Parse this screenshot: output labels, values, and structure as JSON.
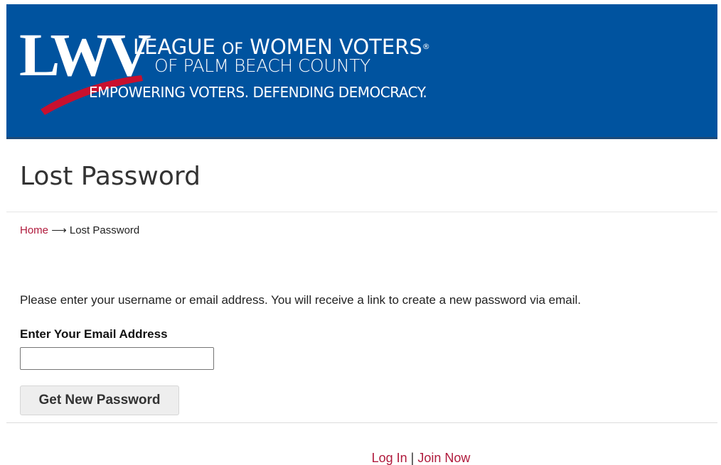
{
  "header": {
    "logo_letters": "LWV",
    "org_name_line1_a": "LEAGUE",
    "org_name_line1_of": "OF",
    "org_name_line1_b": "WOMEN VOTERS",
    "org_name_reg": "®",
    "org_name_line2": "OF PALM BEACH COUNTY",
    "tagline": "EMPOWERING VOTERS. DEFENDING DEMOCRACY.",
    "banner_color": "#00539f",
    "accent_color": "#c8102e"
  },
  "page": {
    "title": "Lost Password"
  },
  "breadcrumb": {
    "home": "Home",
    "separator": "⟶",
    "current": "Lost Password"
  },
  "form": {
    "instructions": "Please enter your username or email address. You will receive a link to create a new password via email.",
    "email_label": "Enter Your Email Address",
    "email_value": "",
    "submit_label": "Get New Password"
  },
  "footer": {
    "login_label": "Log In",
    "divider": "|",
    "join_label": "Join Now"
  }
}
